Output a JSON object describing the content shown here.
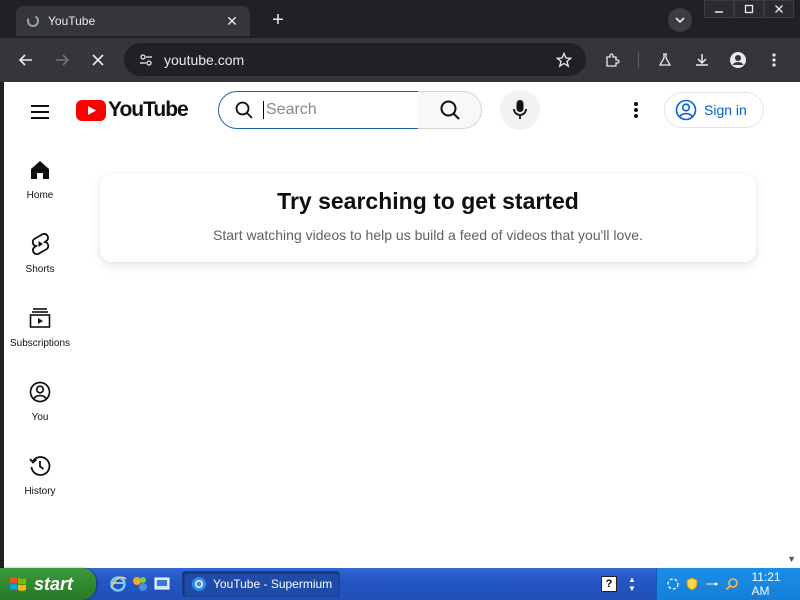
{
  "browser": {
    "tab_title": "YouTube",
    "url": "youtube.com"
  },
  "youtube": {
    "logo_text": "YouTube",
    "search_placeholder": "Search",
    "signin_label": "Sign in",
    "guide": [
      {
        "label": "Home",
        "icon": "home-icon"
      },
      {
        "label": "Shorts",
        "icon": "shorts-icon"
      },
      {
        "label": "Subscriptions",
        "icon": "subscriptions-icon"
      },
      {
        "label": "You",
        "icon": "you-icon"
      },
      {
        "label": "History",
        "icon": "history-icon"
      }
    ],
    "prompt_title": "Try searching to get started",
    "prompt_subtitle": "Start watching videos to help us build a feed of videos that you'll love."
  },
  "taskbar": {
    "start_label": "start",
    "task_label": "YouTube - Supermium",
    "clock": "11:21 AM"
  },
  "colors": {
    "youtube_red": "#ff0000",
    "link_blue": "#065fd4",
    "chrome_dark": "#202124"
  }
}
